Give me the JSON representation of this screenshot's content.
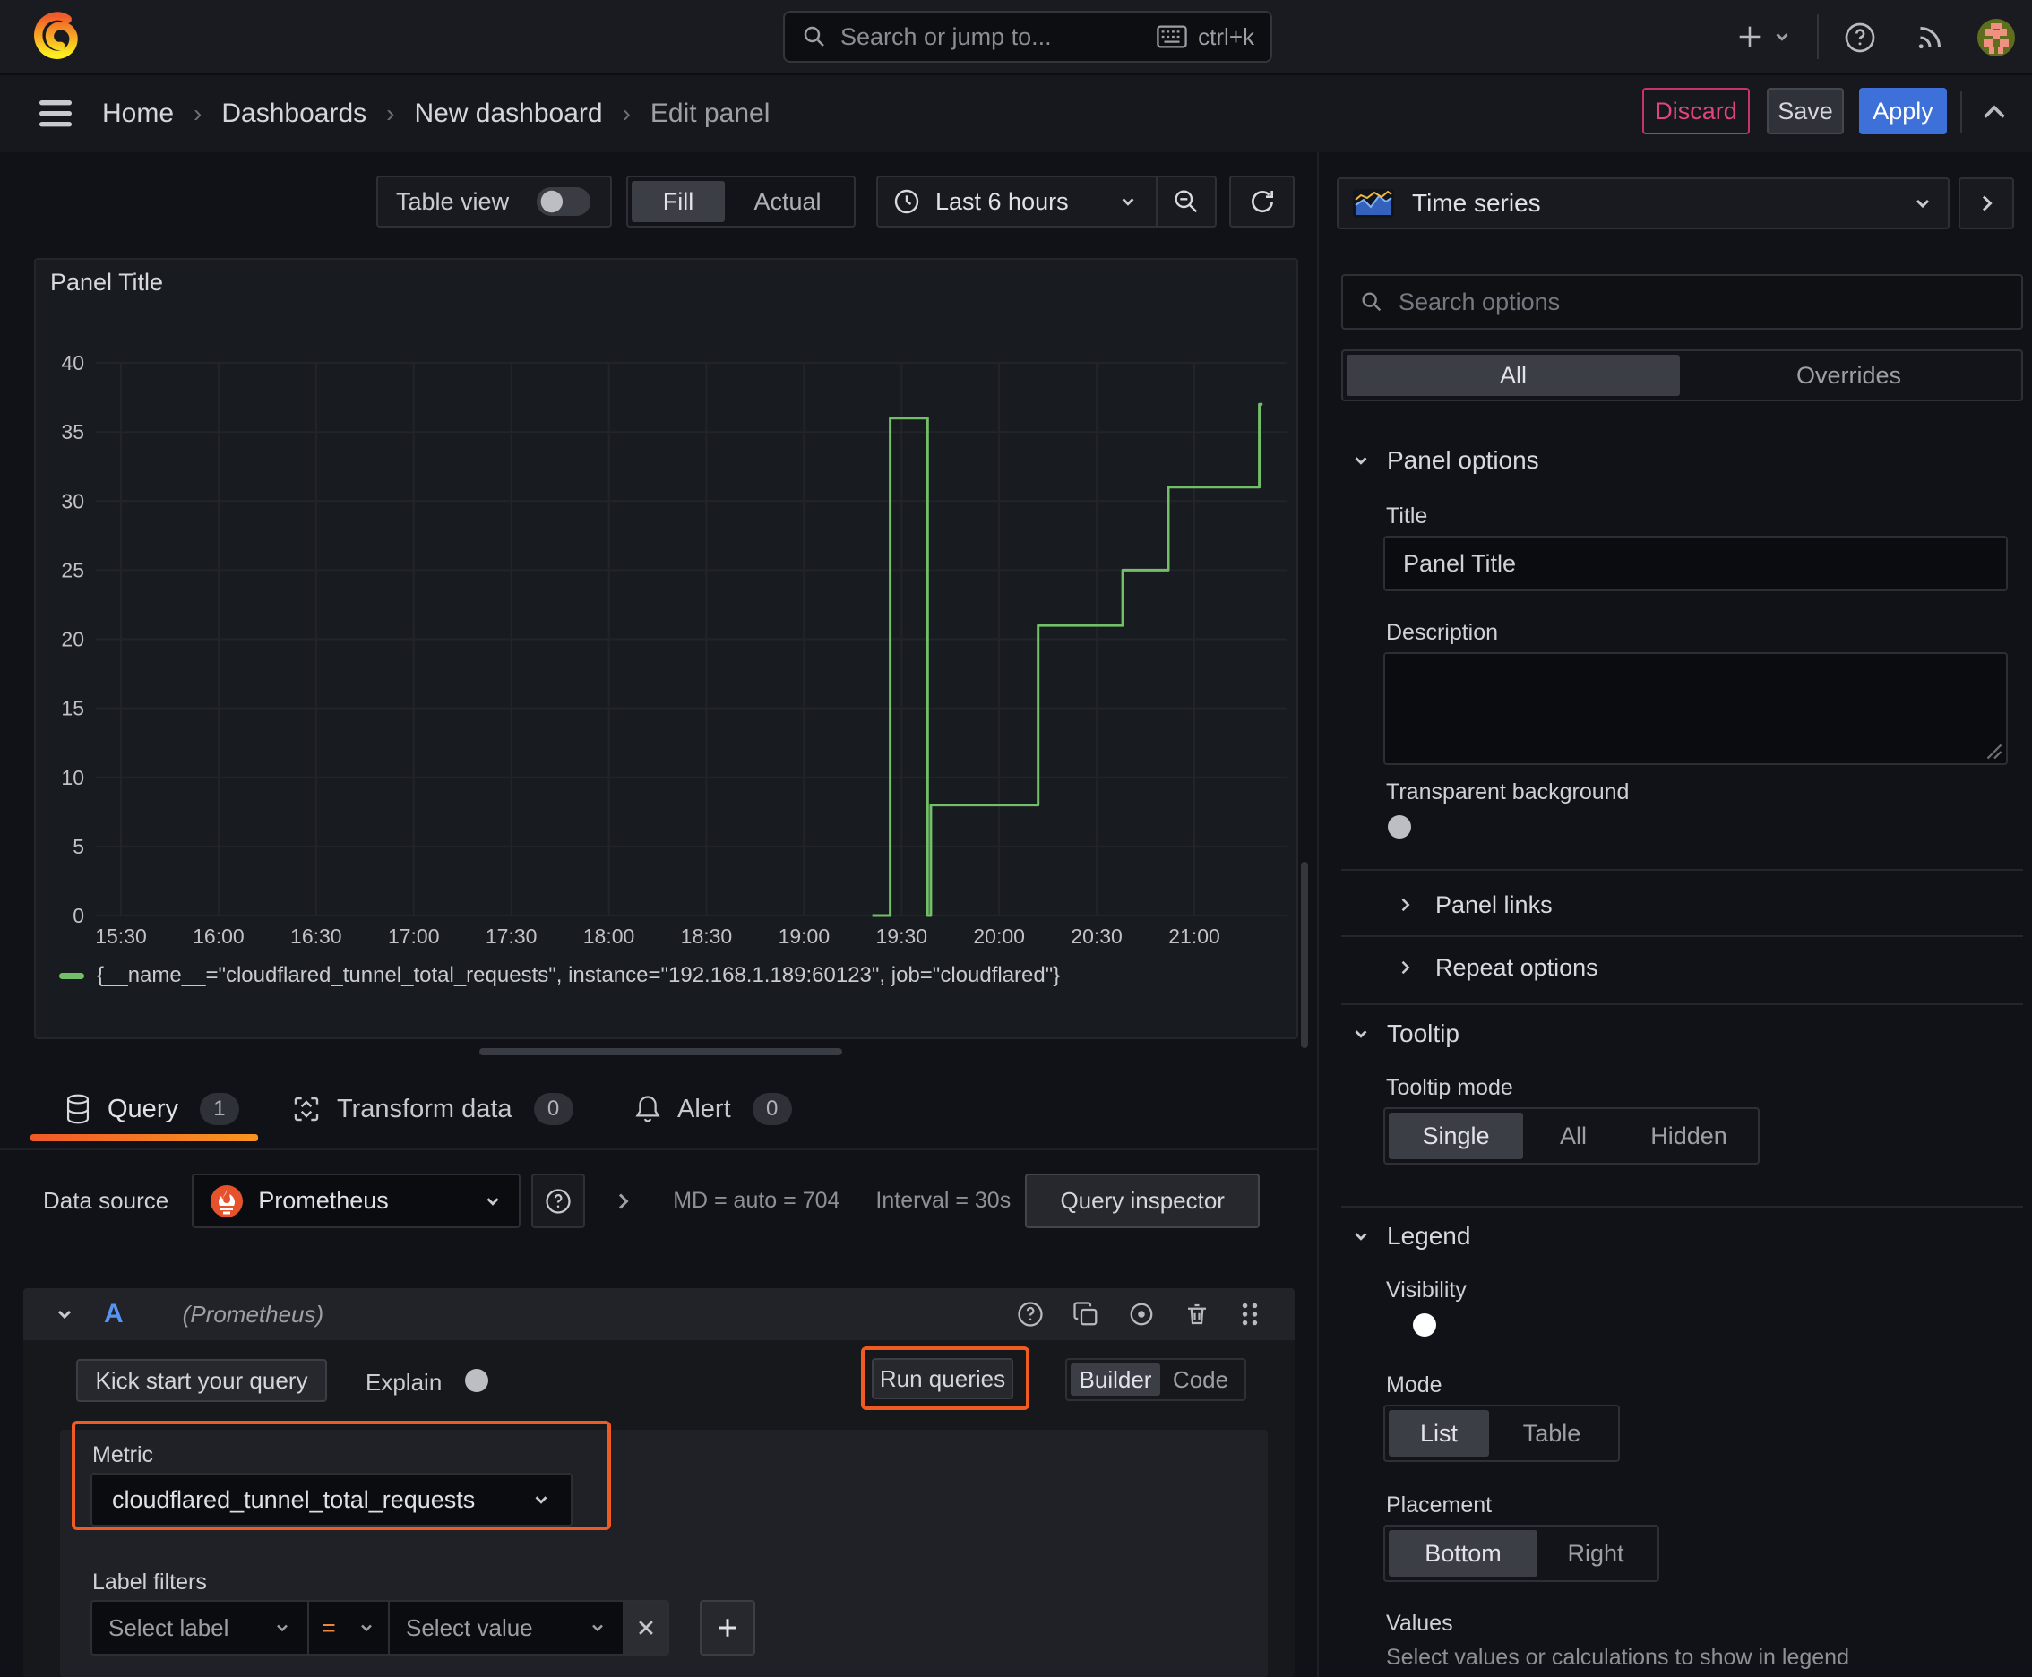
{
  "topbar": {
    "search": {
      "placeholder": "Search or jump to...",
      "shortcut": "ctrl+k"
    }
  },
  "breadcrumb": {
    "home": "Home",
    "dashboards": "Dashboards",
    "new_dashboard": "New dashboard",
    "edit_panel": "Edit panel",
    "discard": "Discard",
    "save": "Save",
    "apply": "Apply"
  },
  "toolbar": {
    "table_view": "Table view",
    "fill": "Fill",
    "actual": "Actual",
    "time_range": "Last 6 hours"
  },
  "panel": {
    "title": "Panel Title"
  },
  "chart_data": {
    "type": "line",
    "title": "Panel Title",
    "x_ticks": [
      "15:30",
      "16:00",
      "16:30",
      "17:00",
      "17:30",
      "18:00",
      "18:30",
      "19:00",
      "19:30",
      "20:00",
      "20:30",
      "21:00"
    ],
    "minutes_per_tick": 30,
    "y_ticks": [
      0,
      5,
      10,
      15,
      20,
      25,
      30,
      35,
      40
    ],
    "ylim": [
      0,
      40
    ],
    "grid": true,
    "legend_position": "bottom",
    "series": [
      {
        "name": "{__name__=\"cloudflared_tunnel_total_requests\", instance=\"192.168.1.189:60123\", job=\"cloudflared\"}",
        "color": "#73bf69",
        "points_minutes_value": [
          [
            231,
            0
          ],
          [
            236.5,
            0
          ],
          [
            236.5,
            36
          ],
          [
            248,
            36
          ],
          [
            248,
            0
          ],
          [
            249,
            0
          ],
          [
            249,
            8
          ],
          [
            282,
            8
          ],
          [
            282,
            21
          ],
          [
            308,
            21
          ],
          [
            308,
            25
          ],
          [
            322,
            25
          ],
          [
            322,
            31
          ],
          [
            350,
            31
          ],
          [
            350,
            37
          ],
          [
            351,
            37
          ]
        ]
      }
    ]
  },
  "tabs": {
    "query": {
      "label": "Query",
      "count": "1"
    },
    "transform": {
      "label": "Transform data",
      "count": "0"
    },
    "alert": {
      "label": "Alert",
      "count": "0"
    }
  },
  "datasource": {
    "label": "Data source",
    "name": "Prometheus",
    "md_stat": "MD = auto = 704",
    "interval_stat": "Interval = 30s",
    "inspector": "Query inspector"
  },
  "query": {
    "ref": "A",
    "hint": "(Prometheus)",
    "kickstart": "Kick start your query",
    "explain": "Explain",
    "run": "Run queries",
    "builder": "Builder",
    "code": "Code",
    "metric": {
      "label": "Metric",
      "value": "cloudflared_tunnel_total_requests"
    },
    "filters": {
      "label": "Label filters",
      "select_label": "Select label",
      "operator": "=",
      "select_value": "Select value"
    }
  },
  "sidebar": {
    "viz_type": "Time series",
    "search_placeholder": "Search options",
    "tab_all": "All",
    "tab_overrides": "Overrides",
    "panel_options": {
      "header": "Panel options",
      "title_label": "Title",
      "title_value": "Panel Title",
      "description_label": "Description",
      "transparent_label": "Transparent background",
      "panel_links": "Panel links",
      "repeat_options": "Repeat options"
    },
    "tooltip": {
      "header": "Tooltip",
      "mode_label": "Tooltip mode",
      "single": "Single",
      "all": "All",
      "hidden": "Hidden"
    },
    "legend": {
      "header": "Legend",
      "visibility_label": "Visibility",
      "mode_label": "Mode",
      "list": "List",
      "table": "Table",
      "placement_label": "Placement",
      "bottom": "Bottom",
      "right": "Right",
      "values_label": "Values",
      "values_hint": "Select values or calculations to show in legend"
    }
  },
  "colors": {
    "accent_orange": "#f05a23",
    "accent_blue": "#3d71d9",
    "series_green": "#73bf69",
    "discard_pink": "#e0457b"
  }
}
